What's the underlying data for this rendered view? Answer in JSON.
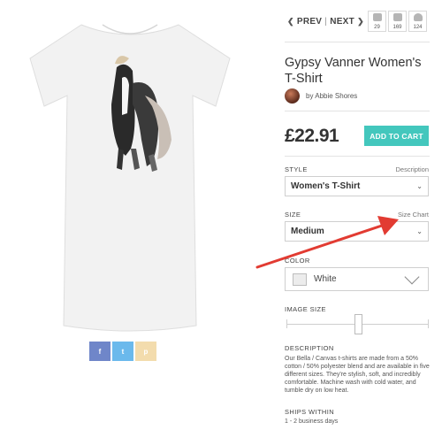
{
  "nav": {
    "prev": "PREV",
    "separator": "|",
    "next": "NEXT",
    "left_icon": "chevron-left-icon",
    "right_icon": "chevron-right-icon"
  },
  "stats": [
    {
      "icon": "comment-icon",
      "count": "29"
    },
    {
      "icon": "like-icon",
      "count": "169"
    },
    {
      "icon": "heart-icon",
      "count": "124"
    }
  ],
  "product": {
    "title": "Gypsy Vanner Women's T-Shirt",
    "artist": "by Abbie Shores",
    "price": "£22.91",
    "add_to_cart": "ADD TO CART"
  },
  "style": {
    "label": "STYLE",
    "link": "Description",
    "value": "Women's T-Shirt"
  },
  "size": {
    "label": "SIZE",
    "link": "Size Chart",
    "value": "Medium"
  },
  "color": {
    "label": "COLOR",
    "value": "White"
  },
  "image_size": {
    "label": "IMAGE SIZE",
    "level_fraction": 0.5
  },
  "description": {
    "label": "DESCRIPTION",
    "text": "Our Bella / Canvas t-shirts are made from a 50% cotton / 50% polyester blend and are available in five different sizes.  They're stylish, soft, and incredibly comfortable.  Machine wash with cold water, and tumble dry on low heat."
  },
  "ships": {
    "label": "SHIPS WITHIN",
    "value": "1 - 2 business days"
  },
  "share": [
    {
      "icon": "facebook-icon",
      "glyph": "f"
    },
    {
      "icon": "twitter-icon",
      "glyph": "t"
    },
    {
      "icon": "pinterest-icon",
      "glyph": "p"
    }
  ],
  "colors": {
    "accent": "#43c7bd",
    "annotation": "#e23b32",
    "facebook": "#6f86c9",
    "twitter": "#6bb9ec",
    "pinterest": "#f3dcad"
  }
}
